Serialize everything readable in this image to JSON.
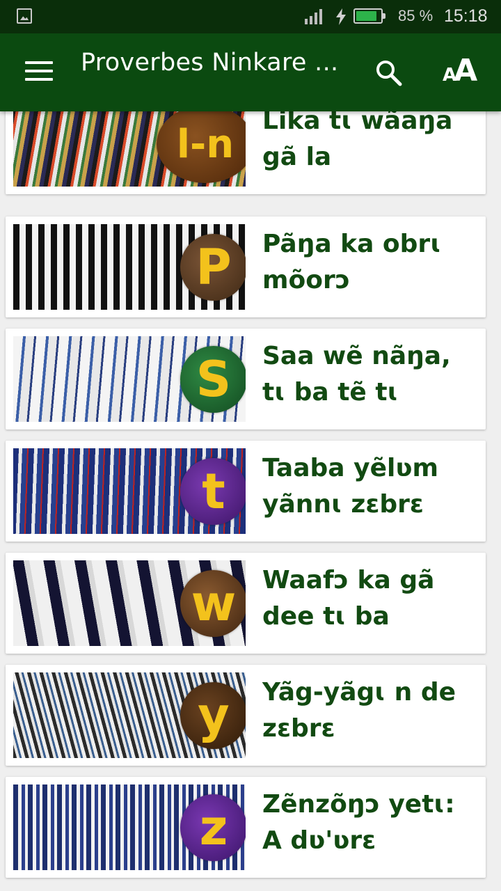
{
  "status_bar": {
    "battery_percent_text": "85 %",
    "battery_level": 0.85,
    "time": "15:18"
  },
  "app_bar": {
    "title": "Proverbes Ninkare ...",
    "menu_icon": "hamburger-menu-icon",
    "search_icon": "search-icon",
    "font_size_icon": "font-size-icon",
    "font_small": "A",
    "font_big": "A"
  },
  "items": [
    {
      "letter": "l-n",
      "title": "Lika tɩ wãaŋa gã la",
      "badge_color": "#6b3a12"
    },
    {
      "letter": "P",
      "title": "Pãŋa ka obrɩ mõorɔ",
      "badge_color": "#5a3a22"
    },
    {
      "letter": "S",
      "title": "Saa wẽ nãŋa, tɩ ba tẽ tɩ",
      "badge_color": "#1f6b2e"
    },
    {
      "letter": "t",
      "title": "Taaba yẽlʋm yãnnɩ zɛbrɛ",
      "badge_color": "#5a1f8c"
    },
    {
      "letter": "w",
      "title": "Waafɔ ka gã dee tɩ ba",
      "badge_color": "#5e3b1d"
    },
    {
      "letter": "y",
      "title": "Yãg-yãgɩ n de zɛbrɛ",
      "badge_color": "#4a2a12"
    },
    {
      "letter": "z",
      "title": "Zẽnzõŋɔ yetɩ: A dʋ'ʋrɛ",
      "badge_color": "#5b1f8a"
    }
  ]
}
